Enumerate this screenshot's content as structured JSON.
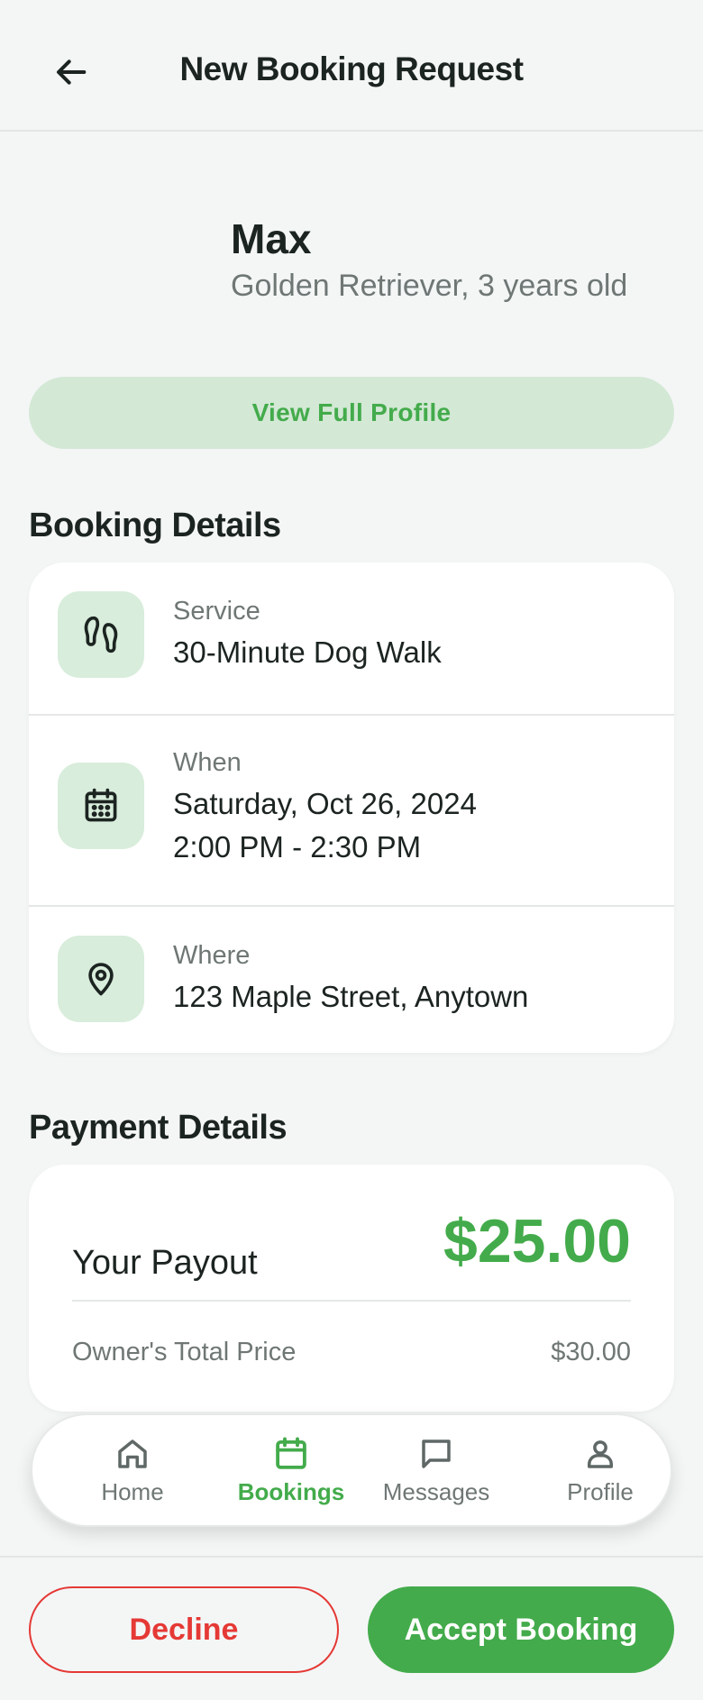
{
  "header": {
    "title": "New Booking Request",
    "back_icon": "arrow-left-icon"
  },
  "pet": {
    "name": "Max",
    "description": "Golden Retriever, 3 years old"
  },
  "view_profile_label": "View Full Profile",
  "booking": {
    "section_title": "Booking Details",
    "service": {
      "label": "Service",
      "value": "30-Minute Dog Walk",
      "icon": "footprints-icon"
    },
    "when": {
      "label": "When",
      "date": "Saturday, Oct 26, 2024",
      "time": "2:00 PM - 2:30 PM",
      "icon": "calendar-icon"
    },
    "where": {
      "label": "Where",
      "value": "123 Maple Street, Anytown",
      "icon": "map-pin-icon"
    }
  },
  "payment": {
    "section_title": "Payment Details",
    "payout_label": "Your Payout",
    "payout_value": "$25.00",
    "owner_label": "Owner's Total Price",
    "owner_value": "$30.00"
  },
  "tabs": [
    {
      "label": "Home",
      "icon": "home-icon",
      "active": false
    },
    {
      "label": "Bookings",
      "icon": "calendar-icon",
      "active": true
    },
    {
      "label": "Messages",
      "icon": "message-icon",
      "active": false
    },
    {
      "label": "Profile",
      "icon": "user-icon",
      "active": false
    }
  ],
  "actions": {
    "decline_label": "Decline",
    "accept_label": "Accept Booking"
  },
  "colors": {
    "accent": "#43ab4b",
    "accent_light": "#d3e8d5",
    "danger": "#e53935",
    "background": "#f4f6f6"
  }
}
